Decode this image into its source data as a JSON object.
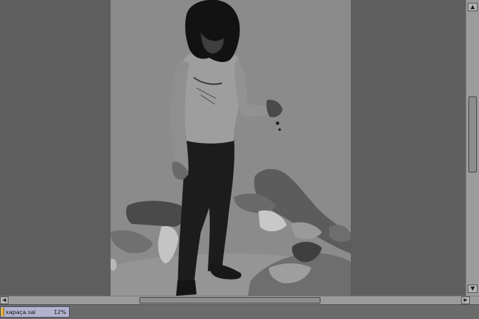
{
  "document": {
    "file_name": "хараҫа.sai",
    "zoom": "12%"
  },
  "scrollbars": {
    "up_icon": "arrow-up-icon",
    "down_icon": "arrow-down-icon",
    "left_icon": "arrow-left-icon",
    "right_icon": "arrow-right-icon"
  },
  "colors": {
    "workspace": "#5e5e5e",
    "canvas_paper": "#8a8a8a",
    "doc_tab": "#b3b3ce"
  }
}
